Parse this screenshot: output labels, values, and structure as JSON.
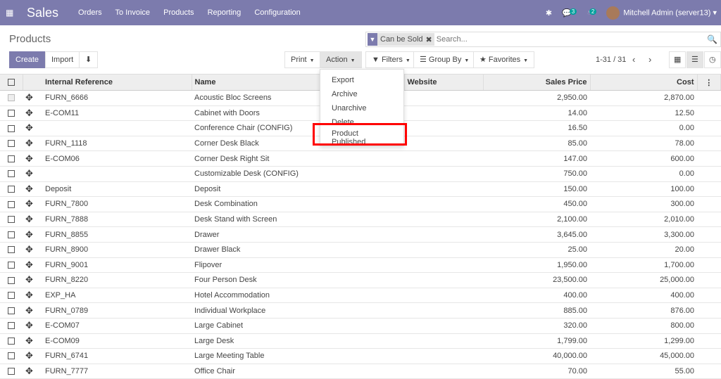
{
  "nav": {
    "app": "Sales",
    "menu": [
      "Orders",
      "To Invoice",
      "Products",
      "Reporting",
      "Configuration"
    ],
    "messages_count": "3",
    "activities_count": "2",
    "user": "Mitchell Admin (server13)"
  },
  "cp": {
    "title": "Products",
    "facet": "Can be Sold",
    "search_placeholder": "Search...",
    "create": "Create",
    "import": "Import",
    "print": "Print",
    "action": "Action",
    "filters": "Filters",
    "group_by": "Group By",
    "favorites": "Favorites",
    "pager": "1-31 / 31"
  },
  "action_menu": [
    "Export",
    "Archive",
    "Unarchive",
    "Delete",
    "Product Published"
  ],
  "columns": [
    "Internal Reference",
    "Name",
    "Website",
    "Sales Price",
    "Cost"
  ],
  "rows": [
    [
      "FURN_6666",
      "Acoustic Bloc Screens",
      "",
      "2,950.00",
      "2,870.00"
    ],
    [
      "E-COM11",
      "Cabinet with Doors",
      "",
      "14.00",
      "12.50"
    ],
    [
      "",
      "Conference Chair (CONFIG)",
      "",
      "16.50",
      "0.00"
    ],
    [
      "FURN_1118",
      "Corner Desk Black",
      "",
      "85.00",
      "78.00"
    ],
    [
      "E-COM06",
      "Corner Desk Right Sit",
      "",
      "147.00",
      "600.00"
    ],
    [
      "",
      "Customizable Desk (CONFIG)",
      "",
      "750.00",
      "0.00"
    ],
    [
      "Deposit",
      "Deposit",
      "",
      "150.00",
      "100.00"
    ],
    [
      "FURN_7800",
      "Desk Combination",
      "",
      "450.00",
      "300.00"
    ],
    [
      "FURN_7888",
      "Desk Stand with Screen",
      "",
      "2,100.00",
      "2,010.00"
    ],
    [
      "FURN_8855",
      "Drawer",
      "",
      "3,645.00",
      "3,300.00"
    ],
    [
      "FURN_8900",
      "Drawer Black",
      "",
      "25.00",
      "20.00"
    ],
    [
      "FURN_9001",
      "Flipover",
      "",
      "1,950.00",
      "1,700.00"
    ],
    [
      "FURN_8220",
      "Four Person Desk",
      "",
      "23,500.00",
      "25,000.00"
    ],
    [
      "EXP_HA",
      "Hotel Accommodation",
      "",
      "400.00",
      "400.00"
    ],
    [
      "FURN_0789",
      "Individual Workplace",
      "",
      "885.00",
      "876.00"
    ],
    [
      "E-COM07",
      "Large Cabinet",
      "",
      "320.00",
      "800.00"
    ],
    [
      "E-COM09",
      "Large Desk",
      "",
      "1,799.00",
      "1,299.00"
    ],
    [
      "FURN_6741",
      "Large Meeting Table",
      "",
      "40,000.00",
      "45,000.00"
    ],
    [
      "FURN_7777",
      "Office Chair",
      "",
      "70.00",
      "55.00"
    ]
  ]
}
